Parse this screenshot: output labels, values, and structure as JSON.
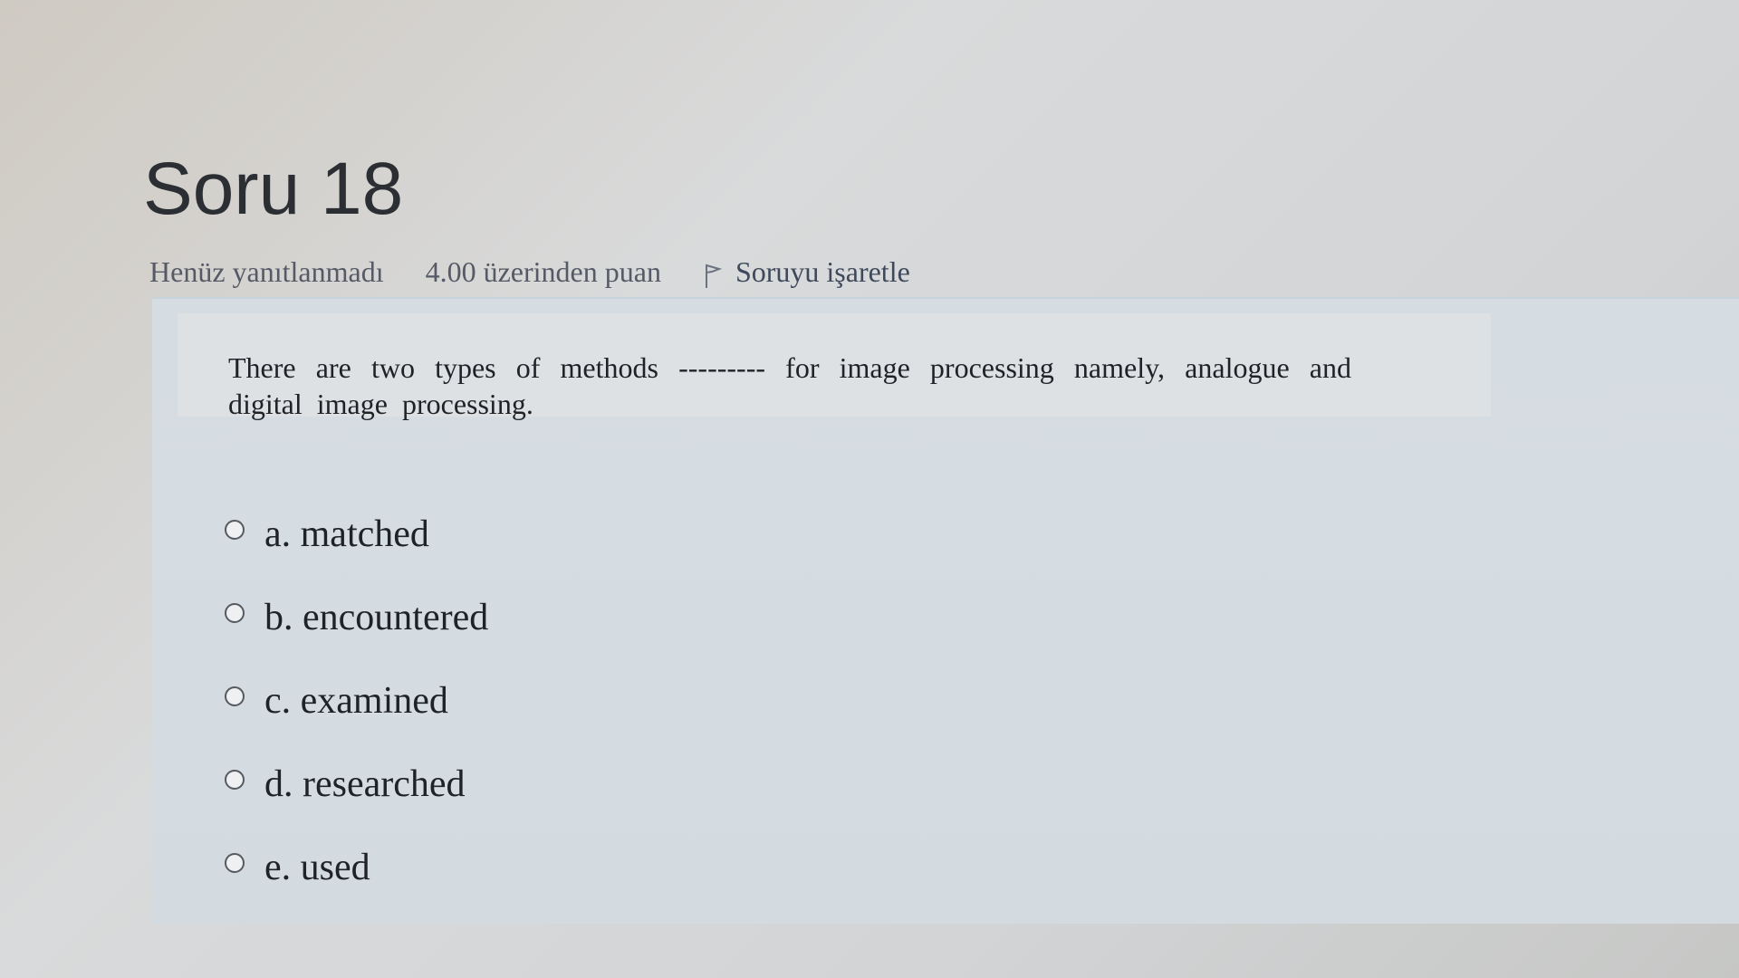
{
  "question": {
    "title": "Soru 18",
    "status": "Henüz yanıtlanmadı",
    "points": "4.00 üzerinden puan",
    "flag_label": "Soruyu işaretle",
    "flag_icon": "flag-icon",
    "text": "There are two types of methods --------- for image processing namely, analogue and digital image processing."
  },
  "answers": [
    {
      "label": "a. matched"
    },
    {
      "label": "b. encountered"
    },
    {
      "label": "c. examined"
    },
    {
      "label": "d. researched"
    },
    {
      "label": "e. used"
    }
  ],
  "colors": {
    "panel_background": "#d6dde2",
    "text": "#1f2226",
    "meta_text": "#555a66"
  }
}
